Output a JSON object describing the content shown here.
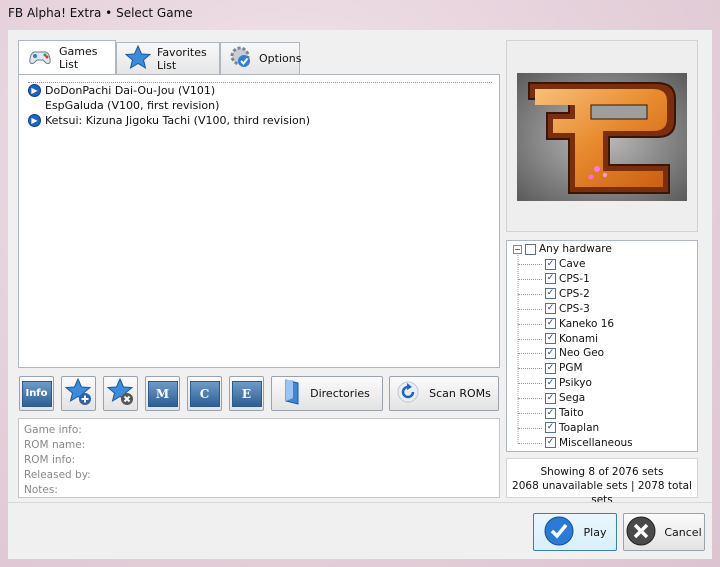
{
  "window": {
    "title": "FB Alpha! Extra • Select Game"
  },
  "tabs": [
    {
      "label": "Games List",
      "icon": "gamepad-icon"
    },
    {
      "label": "Favorites List",
      "icon": "star-icon"
    },
    {
      "label": "Options",
      "icon": "gear-check-icon"
    }
  ],
  "games": [
    {
      "name": "DoDonPachi Dai-Ou-Jou (V101)",
      "expandable": true
    },
    {
      "name": "EspGaluda (V100, first revision)",
      "expandable": false
    },
    {
      "name": "Ketsui: Kizuna Jigoku Tachi (V100, third revision)",
      "expandable": true
    }
  ],
  "toolbar": {
    "info": "Info",
    "m": "M",
    "c": "C",
    "e": "E",
    "directories": "Directories",
    "scan_roms": "Scan ROMs"
  },
  "info_panel": {
    "game_info": "Game info:",
    "rom_name": "ROM name:",
    "rom_info": "ROM info:",
    "released_by": "Released by:",
    "notes": "Notes:"
  },
  "hardware_tree": {
    "root": "Any hardware",
    "items": [
      "Cave",
      "CPS-1",
      "CPS-2",
      "CPS-3",
      "Kaneko 16",
      "Konami",
      "Neo Geo",
      "PGM",
      "Psikyo",
      "Sega",
      "Taito",
      "Toaplan",
      "Miscellaneous"
    ]
  },
  "stats": {
    "showing": "Showing 8 of 2076 sets",
    "totals": "2068 unavailable sets | 2078 total sets"
  },
  "buttons": {
    "play": "Play",
    "cancel": "Cancel"
  },
  "colors": {
    "accent": "#1e63c6",
    "preview_orange": "#e88a2c"
  }
}
